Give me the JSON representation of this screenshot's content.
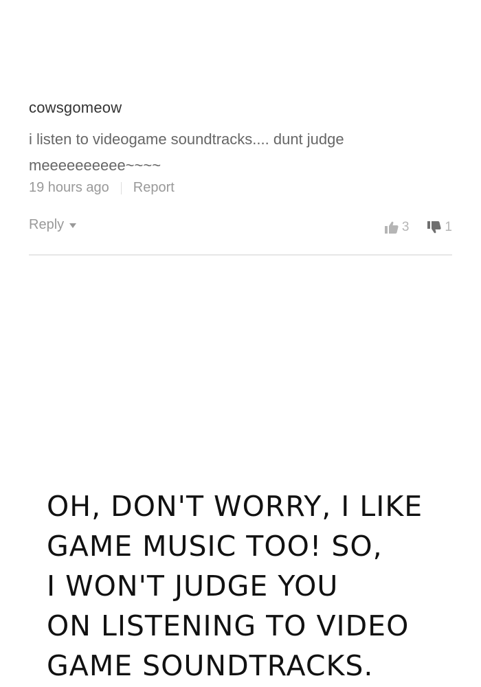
{
  "comment": {
    "username": "cowsgomeow",
    "text": "i listen to videogame soundtracks.... dunt judge meeeeeeeeee~~~~",
    "timestamp": "19 hours ago",
    "report_label": "Report",
    "reply_label": "Reply",
    "upvotes": "3",
    "downvotes": "1"
  },
  "caption": {
    "lines": [
      "OH, DON'T WORRY, I LIKE",
      "GAME MUSIC TOO! SO,",
      "I WON'T JUDGE YOU",
      "ON LISTENING TO VIDEO",
      "GAME SOUNDTRACKS."
    ]
  },
  "icons": {
    "upvote": "thumbs-up-icon",
    "downvote": "thumbs-down-icon",
    "reply_caret": "caret-down-icon"
  },
  "colors": {
    "username": "#333333",
    "body_text": "#666666",
    "meta_text": "#999999",
    "vote_icons": "#b5b5b5",
    "divider": "#e6e6e6",
    "caption": "#111111"
  }
}
